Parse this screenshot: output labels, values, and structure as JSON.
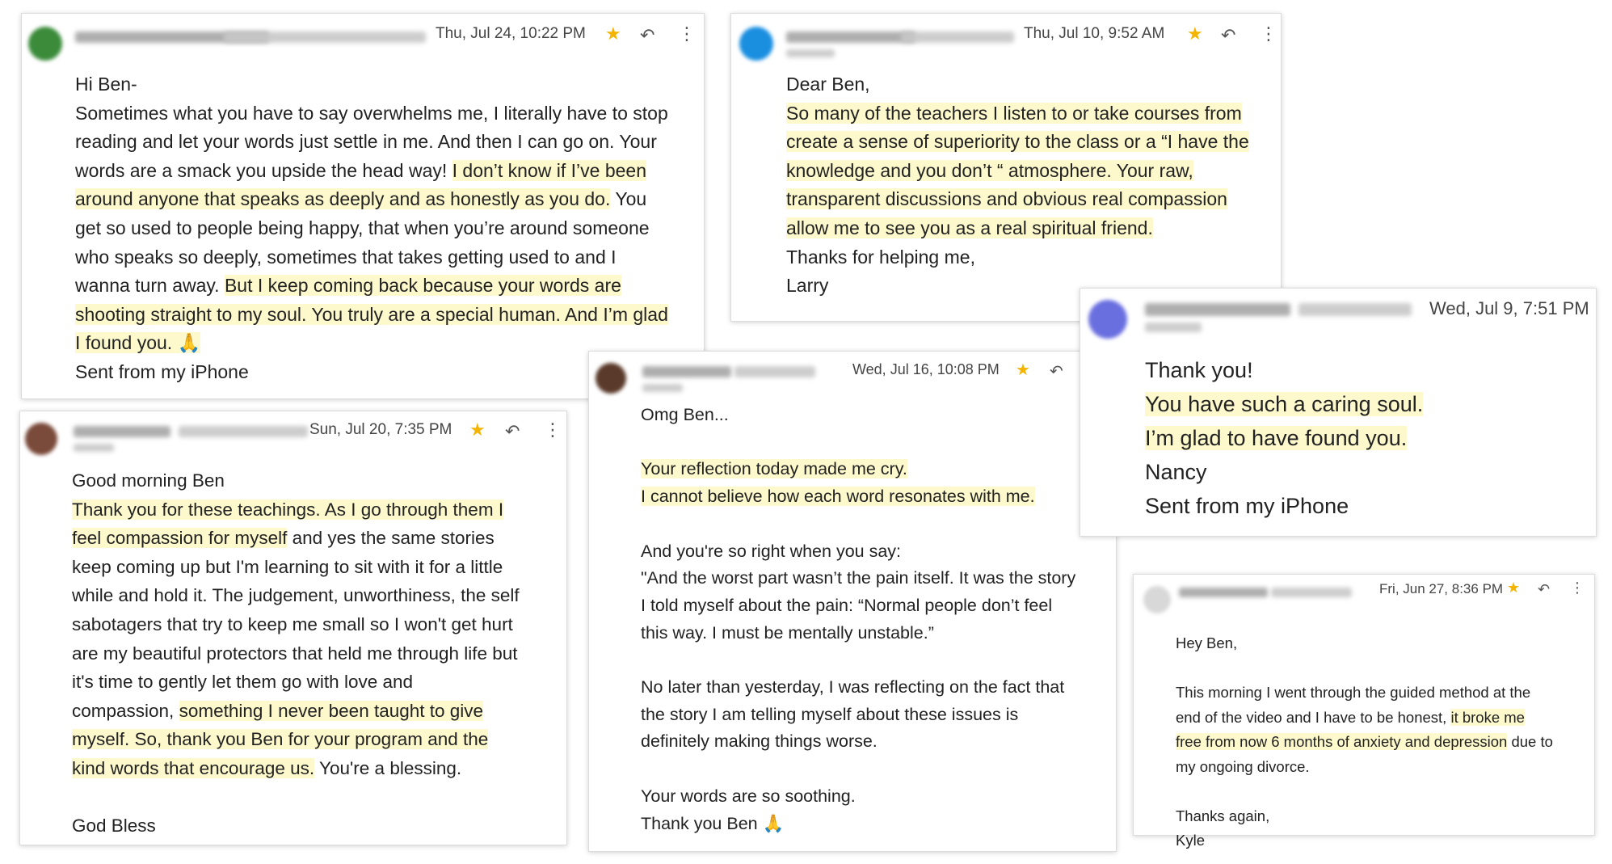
{
  "emails": [
    {
      "id": "email-1",
      "date": "Thu, Jul 24, 10:22 PM",
      "avatar_color": "#3b8b3b",
      "lines": [
        [
          {
            "t": "Hi Ben-",
            "h": false
          }
        ],
        [
          {
            "t": "Sometimes what you have to say overwhelms me, I literally have to stop",
            "h": false
          }
        ],
        [
          {
            "t": "reading and let your words just settle in me. And then I can go on. Your",
            "h": false
          }
        ],
        [
          {
            "t": "words are a smack you upside the head way! ",
            "h": false
          },
          {
            "t": "I don’t know if I’ve been",
            "h": true
          }
        ],
        [
          {
            "t": "around anyone that speaks as deeply and as honestly as you do.",
            "h": true
          },
          {
            "t": " You",
            "h": false
          }
        ],
        [
          {
            "t": "get so used to people being happy, that when you’re around someone",
            "h": false
          }
        ],
        [
          {
            "t": "who speaks so deeply, sometimes that takes getting used to and I",
            "h": false
          }
        ],
        [
          {
            "t": "wanna turn away. ",
            "h": false
          },
          {
            "t": "But I keep coming back because your words are",
            "h": true
          }
        ],
        [
          {
            "t": "shooting straight to my soul. You truly are a special human. And I’m glad",
            "h": true
          }
        ],
        [
          {
            "t": "I found you. 🙏",
            "h": true
          }
        ],
        [
          {
            "t": "Sent from my iPhone",
            "h": false
          }
        ]
      ]
    },
    {
      "id": "email-2",
      "date": "Thu, Jul 10, 9:52 AM",
      "avatar_color": "#1a8fe0",
      "lines": [
        [
          {
            "t": "Dear Ben,",
            "h": false
          }
        ],
        [
          {
            "t": "So many of the teachers I listen to or take courses from",
            "h": true
          }
        ],
        [
          {
            "t": "create a sense of superiority to the class or a “I have the",
            "h": true
          }
        ],
        [
          {
            "t": "knowledge and you don’t “ atmosphere. Your raw,",
            "h": true
          }
        ],
        [
          {
            "t": "transparent discussions and obvious real compassion",
            "h": true
          }
        ],
        [
          {
            "t": "allow me to see you as a real spiritual friend.",
            "h": true
          }
        ],
        [
          {
            "t": "Thanks for helping me,",
            "h": false
          }
        ],
        [
          {
            "t": "Larry",
            "h": false
          }
        ]
      ]
    },
    {
      "id": "email-3",
      "date": "Wed, Jul 9, 7:51 PM",
      "avatar_color": "#6a6fe0",
      "lines": [
        [
          {
            "t": "Thank you!",
            "h": false
          }
        ],
        [
          {
            "t": "You have such a caring soul.",
            "h": true
          }
        ],
        [
          {
            "t": "I’m glad to have found you.",
            "h": true
          }
        ],
        [
          {
            "t": "Nancy",
            "h": false
          }
        ],
        [
          {
            "t": "Sent from my iPhone",
            "h": false
          }
        ]
      ]
    },
    {
      "id": "email-4",
      "date": "Sun, Jul 20, 7:35 PM",
      "avatar_color": "#7a4a3a",
      "lines": [
        [
          {
            "t": "Good morning Ben",
            "h": false
          }
        ],
        [
          {
            "t": "Thank you for these teachings.  As I go through them I",
            "h": true
          }
        ],
        [
          {
            "t": "feel compassion for myself",
            "h": true
          },
          {
            "t": " and yes the same stories",
            "h": false
          }
        ],
        [
          {
            "t": "keep coming up but I'm learning to sit with it for a little",
            "h": false
          }
        ],
        [
          {
            "t": "while and hold it.  The judgement, unworthiness, the self",
            "h": false
          }
        ],
        [
          {
            "t": "sabotagers that try to keep me small so I won't get hurt",
            "h": false
          }
        ],
        [
          {
            "t": "are my beautiful protectors that held me through life but",
            "h": false
          }
        ],
        [
          {
            "t": "it's time to gently let them go with love and",
            "h": false
          }
        ],
        [
          {
            "t": "compassion, ",
            "h": false
          },
          {
            "t": "something I never been taught to give",
            "h": true
          }
        ],
        [
          {
            "t": "myself.  So, thank you Ben for your program and the",
            "h": true
          }
        ],
        [
          {
            "t": "kind words that encourage us.",
            "h": true
          },
          {
            "t": " You're a blessing.",
            "h": false
          }
        ],
        [
          {
            "t": "",
            "h": false
          }
        ],
        [
          {
            "t": "God Bless",
            "h": false
          }
        ]
      ]
    },
    {
      "id": "email-5",
      "date": "Wed, Jul 16, 10:08 PM",
      "avatar_color": "#5a3a2a",
      "lines": [
        [
          {
            "t": "Omg Ben...",
            "h": false
          }
        ],
        [
          {
            "t": "",
            "h": false
          }
        ],
        [
          {
            "t": "Your reflection today made me cry.",
            "h": true
          }
        ],
        [
          {
            "t": "I cannot believe how each word resonates with me.",
            "h": true
          }
        ],
        [
          {
            "t": "",
            "h": false
          }
        ],
        [
          {
            "t": "And you're so right when you say:",
            "h": false
          }
        ],
        [
          {
            "t": "\"And the worst part wasn’t the pain itself. It was the story",
            "h": false
          }
        ],
        [
          {
            "t": "I told myself about the pain: “Normal people don’t feel",
            "h": false
          }
        ],
        [
          {
            "t": "this way.  I must be mentally unstable.”",
            "h": false
          }
        ],
        [
          {
            "t": "",
            "h": false
          }
        ],
        [
          {
            "t": "No later than yesterday, I was reflecting on the fact that",
            "h": false
          }
        ],
        [
          {
            "t": "the story I am telling myself about these issues is",
            "h": false
          }
        ],
        [
          {
            "t": "definitely making things worse.",
            "h": false
          }
        ],
        [
          {
            "t": "",
            "h": false
          }
        ],
        [
          {
            "t": "Your words are so soothing.",
            "h": false
          }
        ],
        [
          {
            "t": "Thank you Ben 🙏",
            "h": false
          }
        ]
      ]
    },
    {
      "id": "email-6",
      "date": "Fri, Jun 27, 8:36 PM",
      "avatar_color": "#d8d8d8",
      "lines": [
        [
          {
            "t": "Hey Ben,",
            "h": false
          }
        ],
        [
          {
            "t": "",
            "h": false
          }
        ],
        [
          {
            "t": "This morning I went through the guided method at the",
            "h": false
          }
        ],
        [
          {
            "t": "end of the video and I have to be honest, ",
            "h": false
          },
          {
            "t": "it broke me",
            "h": true
          }
        ],
        [
          {
            "t": "free from now 6 months of anxiety and depression",
            "h": true
          },
          {
            "t": " due to",
            "h": false
          }
        ],
        [
          {
            "t": "my ongoing divorce.",
            "h": false
          }
        ],
        [
          {
            "t": "",
            "h": false
          }
        ],
        [
          {
            "t": "Thanks again,",
            "h": false
          }
        ],
        [
          {
            "t": "Kyle",
            "h": false
          }
        ]
      ]
    }
  ],
  "icons": {
    "star": "star-icon",
    "reply": "reply-icon",
    "more": "more-vert-icon"
  },
  "colors": {
    "highlight": "#fdf9cd",
    "star": "#f4b400"
  }
}
